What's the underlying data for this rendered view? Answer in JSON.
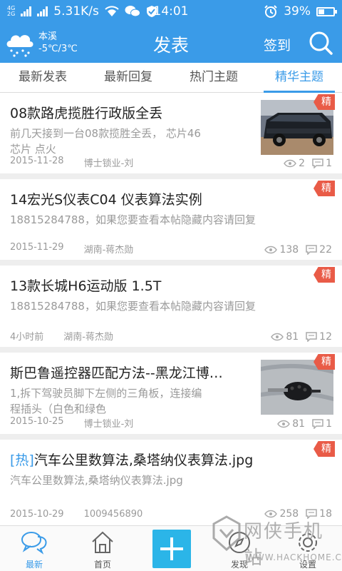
{
  "status_bar": {
    "network_tag_top": "4G",
    "network_tag_bottom": "2G",
    "net_speed": "5.31K/s",
    "time": "14:01",
    "battery": "39%"
  },
  "header": {
    "weather_city": "本溪",
    "weather_temp": "-5℃/3℃",
    "title": "发表",
    "signin_label": "签到"
  },
  "tabs": [
    {
      "label": "最新发表"
    },
    {
      "label": "最新回复"
    },
    {
      "label": "热门主题"
    },
    {
      "label": "精华主题"
    }
  ],
  "active_tab": "精华主题",
  "posts": [
    {
      "title": "08款路虎揽胜行政版全丢",
      "excerpt_line1": "前几天接到一台08款揽胜全丢，  芯片46",
      "excerpt_line2": "芯片   点火",
      "date": "2015-11-28",
      "author": "博士锁业-刘",
      "views": "2",
      "replies": "1",
      "badge": "精"
    },
    {
      "title": "14宏光S仪表C04 仪表算法实例",
      "excerpt_line1": "18815284788，如果您要查看本帖隐藏内容请回复",
      "excerpt_line2": "",
      "date": "2015-11-29",
      "author": "湖南-蒋杰勋",
      "views": "138",
      "replies": "22",
      "badge": "精"
    },
    {
      "title": "13款长城H6运动版 1.5T",
      "excerpt_line1": "18815284788，如果您要查看本帖隐藏内容请回复",
      "excerpt_line2": "",
      "date": "4小时前",
      "author": "湖南-蒋杰勋",
      "views": "81",
      "replies": "12",
      "badge": "精"
    },
    {
      "title": "斯巴鲁遥控器匹配方法--黑龙江博…",
      "excerpt_line1": "1,拆下驾驶员脚下左侧的三角板，连接编",
      "excerpt_line2": "程插头（白色和绿色",
      "date": "2015-10-25",
      "author": "博士锁业-刘",
      "views": "81",
      "replies": "1",
      "badge": "精"
    },
    {
      "title_prefix": "[热]",
      "title": "汽车公里数算法,桑塔纳仪表算法.jpg",
      "excerpt_line1": "汽车公里数算法,桑塔纳仪表算法.jpg",
      "excerpt_line2": "",
      "date": "2015-10-29",
      "author": "1009456890",
      "views": "258",
      "replies": "18",
      "badge": "精"
    }
  ],
  "bottom_nav": {
    "latest_label": "最新",
    "home_label": "首页",
    "find_label": "发现",
    "settings_label": "设置"
  },
  "watermark": {
    "main": "网侠手机站",
    "sub": "WWW.HACKHOME.COM"
  },
  "colors": {
    "accent": "#3a9be8",
    "badge": "#e95b47",
    "post_button": "#2bb5e8"
  }
}
